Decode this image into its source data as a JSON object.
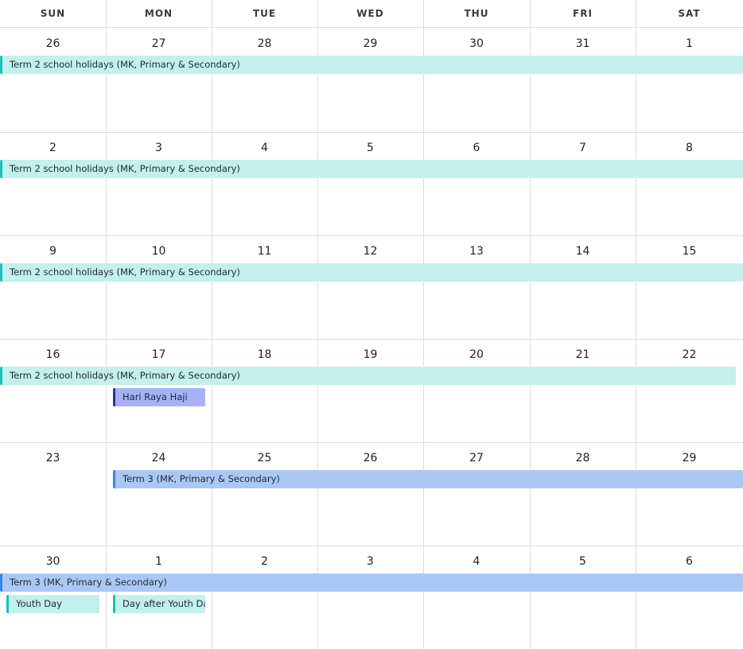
{
  "calendar": {
    "weekdays": [
      "SUN",
      "MON",
      "TUE",
      "WED",
      "THU",
      "FRI",
      "SAT"
    ],
    "weeks": [
      {
        "days": [
          "26",
          "27",
          "28",
          "29",
          "30",
          "31",
          "1"
        ],
        "events": [
          {
            "title": "Term 2 school holidays (MK, Primary & Secondary)",
            "color": "teal",
            "start": 0,
            "span": 7
          }
        ]
      },
      {
        "days": [
          "2",
          "3",
          "4",
          "5",
          "6",
          "7",
          "8"
        ],
        "events": [
          {
            "title": "Term 2 school holidays (MK, Primary & Secondary)",
            "color": "teal",
            "start": 0,
            "span": 7
          }
        ]
      },
      {
        "days": [
          "9",
          "10",
          "11",
          "12",
          "13",
          "14",
          "15"
        ],
        "events": [
          {
            "title": "Term 2 school holidays (MK, Primary & Secondary)",
            "color": "teal",
            "start": 0,
            "span": 7
          }
        ]
      },
      {
        "days": [
          "16",
          "17",
          "18",
          "19",
          "20",
          "21",
          "22"
        ],
        "events": [
          {
            "title": "Term 2 school holidays (MK, Primary & Secondary)",
            "color": "teal",
            "start": 0,
            "span": 7
          },
          {
            "title": "Hari Raya Haji",
            "color": "purple",
            "start": 1,
            "span": 1
          }
        ]
      },
      {
        "days": [
          "23",
          "24",
          "25",
          "26",
          "27",
          "28",
          "29"
        ],
        "events": [
          {
            "title": "Term 3 (MK, Primary & Secondary)",
            "color": "blue",
            "start": 1,
            "span": 6
          }
        ]
      },
      {
        "days": [
          "30",
          "1",
          "2",
          "3",
          "4",
          "5",
          "6"
        ],
        "events": [
          {
            "title": "Term 3 (MK, Primary & Secondary)",
            "color": "blue",
            "start": 0,
            "span": 7
          },
          {
            "title": "Youth Day",
            "color": "teal",
            "start": 0,
            "span": 1
          },
          {
            "title": "Day after Youth Day",
            "color": "teal",
            "start": 1,
            "span": 1
          }
        ]
      }
    ]
  }
}
